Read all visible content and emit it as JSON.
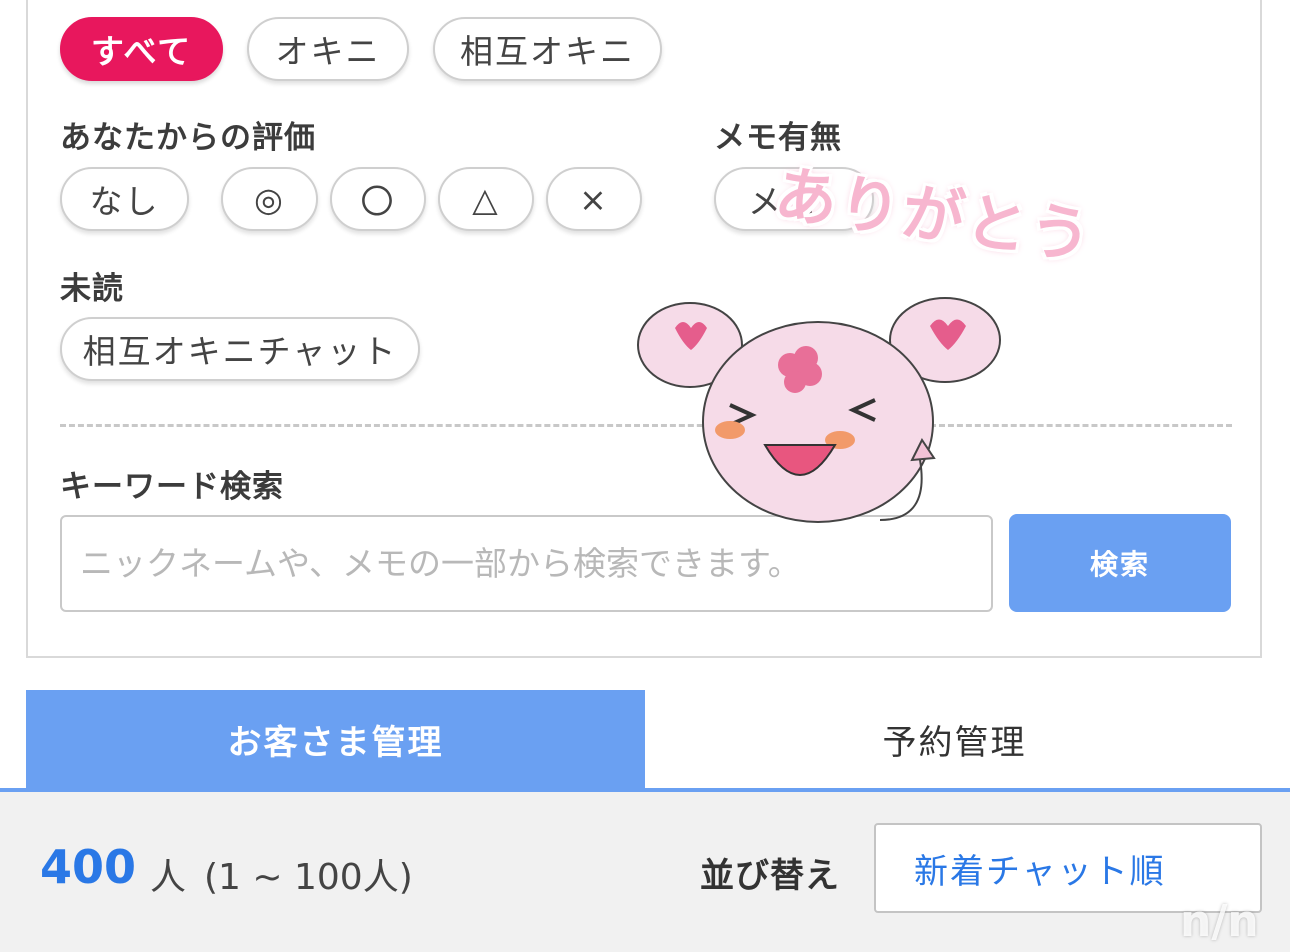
{
  "filters": {
    "follow": {
      "all": "すべて",
      "okini": "オキニ",
      "mutual": "相互オキニ"
    },
    "rating": {
      "label": "あなたからの評価",
      "none": "なし",
      "double_circle": "◎",
      "circle": "〇",
      "triangle": "△",
      "cross": "×"
    },
    "memo": {
      "label": "メモ有無",
      "option": "メモ"
    },
    "unread": {
      "label": "未読",
      "mutual_chat": "相互オキニチャット"
    },
    "keyword": {
      "label": "キーワード検索",
      "placeholder": "ニックネームや、メモの一部から検索できます。",
      "value": "",
      "button": "検索"
    }
  },
  "tabs": {
    "customer": "お客さま管理",
    "reservation": "予約管理"
  },
  "results": {
    "count": "400",
    "unit": "人",
    "range": "(1 ~ 100人)",
    "sort_label": "並び替え",
    "sort_value": "新着チャット順"
  },
  "overlay": {
    "sticker_text": "ありがとう",
    "watermark": "n/n"
  },
  "colors": {
    "accent_pink": "#e8175d",
    "accent_blue": "#6aa0f2",
    "link_blue": "#2a78e6"
  }
}
